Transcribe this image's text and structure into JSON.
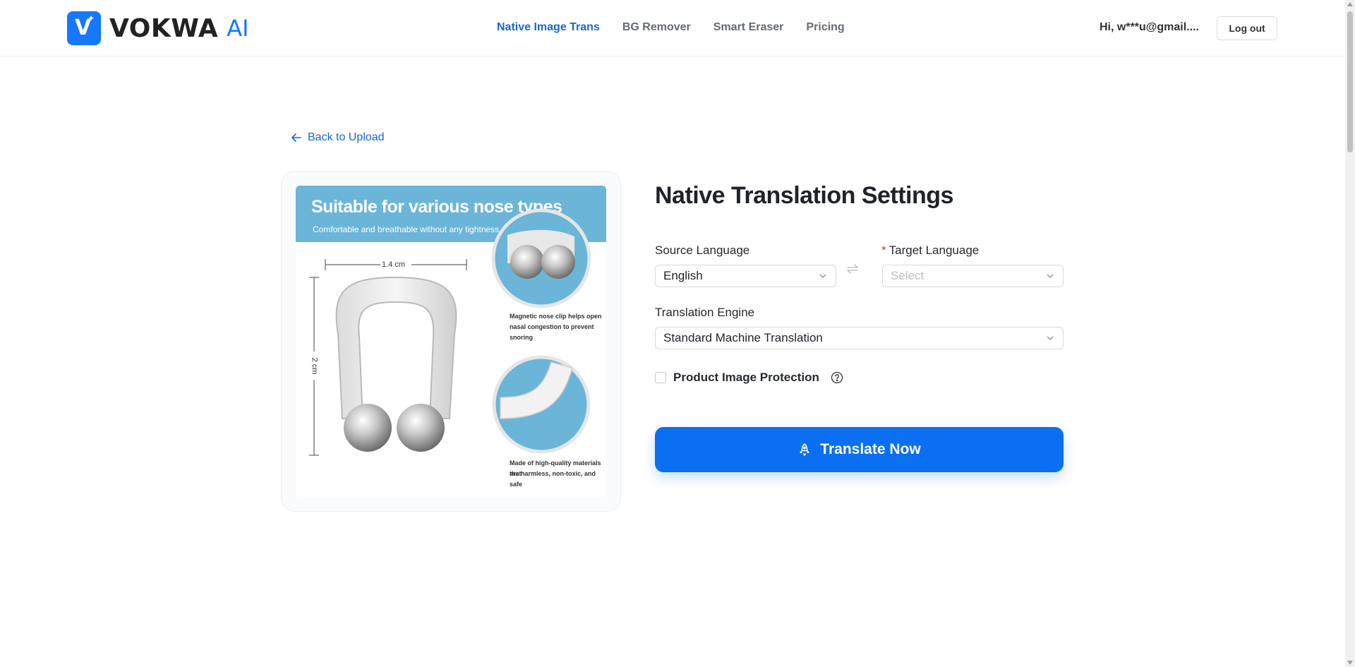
{
  "brand": {
    "name": "VOKWA",
    "suffix": "AI",
    "accent": "#1677ff"
  },
  "nav": {
    "items": [
      {
        "label": "Native Image Trans",
        "active": true
      },
      {
        "label": "BG Remover",
        "active": false
      },
      {
        "label": "Smart Eraser",
        "active": false
      },
      {
        "label": "Pricing",
        "active": false
      }
    ]
  },
  "user": {
    "greeting": "Hi, w***u@gmail....",
    "logout_label": "Log out"
  },
  "back_label": "Back to Upload",
  "product_image": {
    "banner_title": "Suitable for various nose types",
    "banner_subtitle": "Comfortable and breathable without any tightness",
    "width_label": "1.4 cm",
    "height_label": "2 cm",
    "caption_1_line_1": "Magnetic nose clip helps open",
    "caption_1_line_2": "nasal congestion to prevent snoring",
    "caption_2_line_1": "Made of high-quality materials that",
    "caption_2_line_2": "are harmless, non-toxic, and safe"
  },
  "settings": {
    "title": "Native Translation Settings",
    "source_label": "Source Language",
    "source_value": "English",
    "target_required_mark": "*",
    "target_label": "Target Language",
    "target_placeholder": "Select",
    "engine_label": "Translation Engine",
    "engine_value": "Standard Machine Translation",
    "protection_label": "Product Image Protection",
    "protection_checked": false,
    "translate_label": "Translate Now",
    "button_color": "#0a6ff0"
  }
}
